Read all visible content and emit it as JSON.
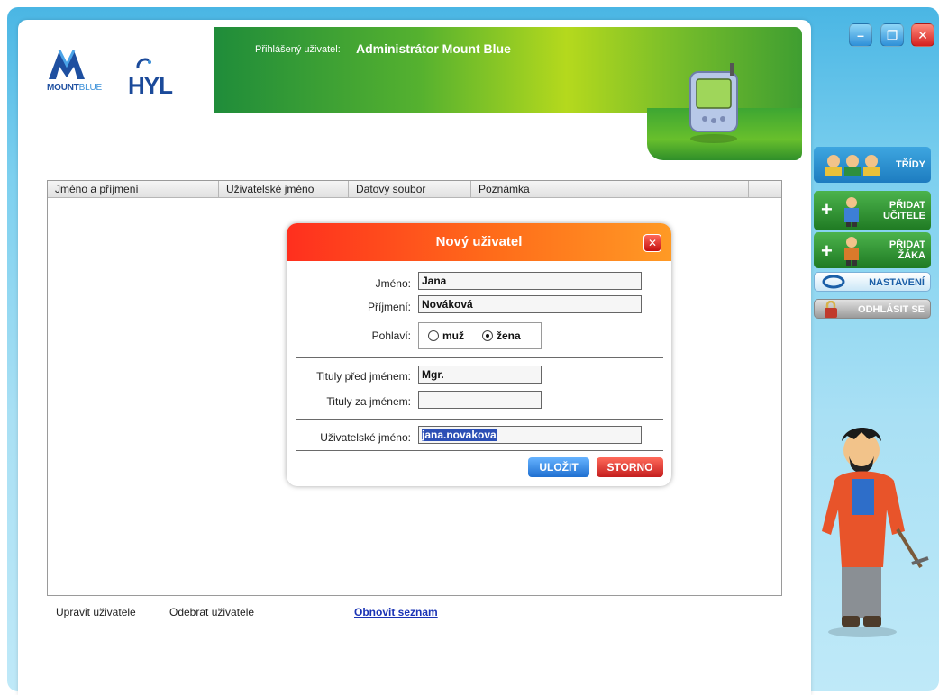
{
  "header": {
    "logged_label": "Přihlášený uživatel:",
    "logged_user": "Administrátor Mount Blue",
    "logo_main": "MOUNT",
    "logo_sub": "BLUE",
    "logo_hyl": "HYL"
  },
  "table": {
    "columns": [
      "Jméno a příjmení",
      "Uživatelské jméno",
      "Datový soubor",
      "Poznámka",
      ""
    ]
  },
  "actions": {
    "edit_user": "Upravit uživatele",
    "remove_user": "Odebrat uživatele",
    "refresh_list": "Obnovit seznam"
  },
  "dialog": {
    "title": "Nový uživatel",
    "labels": {
      "first_name": "Jméno:",
      "last_name": "Příjmení:",
      "gender": "Pohlaví:",
      "title_before": "Tituly před jménem:",
      "title_after": "Tituly za jménem:",
      "username": "Uživatelské jméno:"
    },
    "values": {
      "first_name": "Jana",
      "last_name": "Nováková",
      "title_before": "Mgr.",
      "title_after": "",
      "username": "jana.novakova"
    },
    "gender_options": [
      "muž",
      "žena"
    ],
    "gender_selected": "žena",
    "save": "ULOŽIT",
    "cancel": "STORNO"
  },
  "sidebar": {
    "classes": "TŘÍDY",
    "add_teacher_1": "PŘIDAT",
    "add_teacher_2": "UČITELE",
    "add_student_1": "PŘIDAT",
    "add_student_2": "ŽÁKA",
    "settings": "NASTAVENÍ",
    "logout": "ODHLÁSIT SE"
  },
  "colors": {
    "header_green": "#55b12f",
    "dialog_orange": "#ff6d1a",
    "save_blue": "#1f6fd0",
    "cancel_red": "#c41e1e",
    "link_blue": "#1a33b5"
  }
}
